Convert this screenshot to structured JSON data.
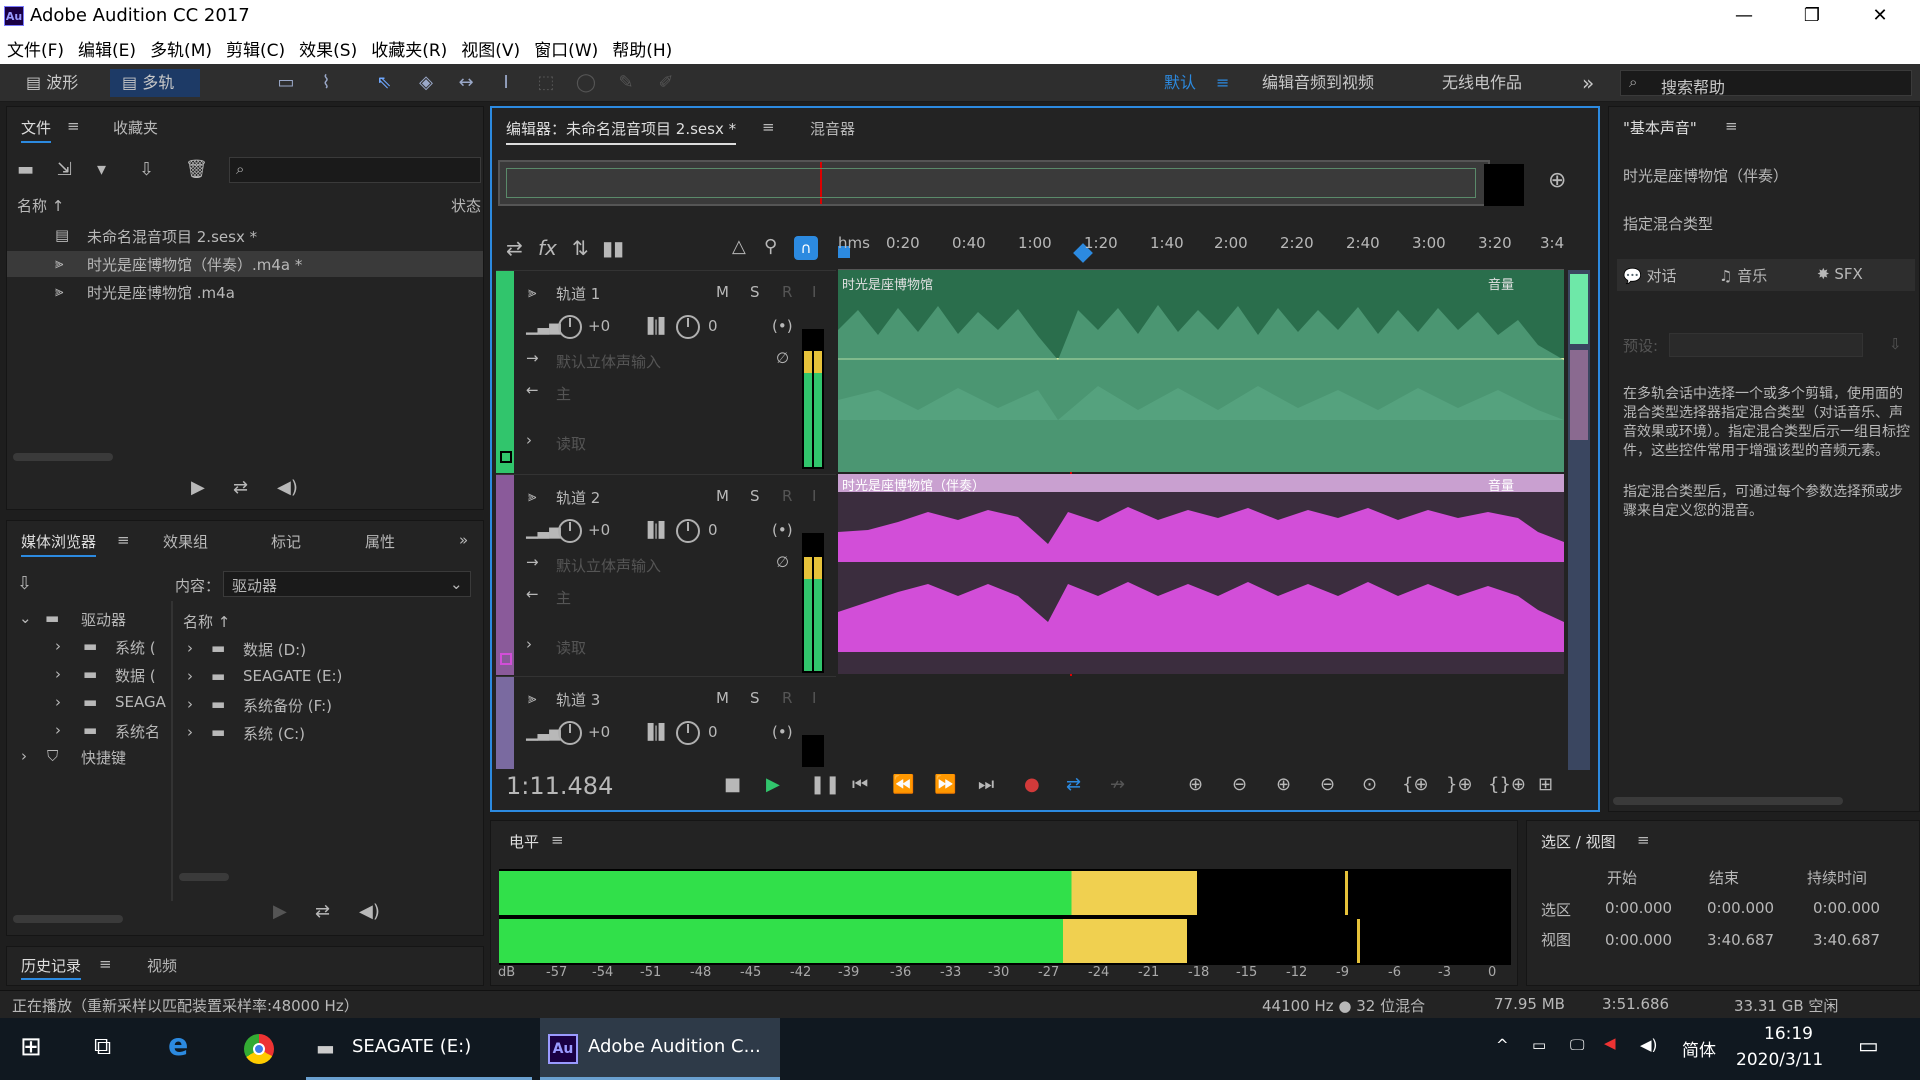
{
  "window": {
    "title": "Adobe Audition CC 2017",
    "logo": "Au",
    "minimize": "—",
    "restore": "❐",
    "close": "✕"
  },
  "menu": [
    "文件(F)",
    "编辑(E)",
    "多轨(M)",
    "剪辑(C)",
    "效果(S)",
    "收藏夹(R)",
    "视图(V)",
    "窗口(W)",
    "帮助(H)"
  ],
  "toolbar": {
    "waveform": "波形",
    "multitrack": "多轨",
    "workspace_default": "默认",
    "workspace_video": "编辑音频到视频",
    "workspace_radio": "无线电作品",
    "more": "»",
    "search_placeholder": "搜索帮助"
  },
  "files_panel": {
    "tabs": [
      "文件",
      "收藏夹"
    ],
    "col_name": "名称 ↑",
    "col_status": "状态",
    "items": [
      {
        "name": "未命名混音项目 2.sesx *",
        "type": "session"
      },
      {
        "name": "时光是座博物馆（伴奏）.m4a *",
        "type": "audio"
      },
      {
        "name": "时光是座博物馆 .m4a",
        "type": "audio"
      }
    ]
  },
  "media_browser": {
    "tabs": [
      "媒体浏览器",
      "效果组",
      "标记",
      "属性"
    ],
    "content_label": "内容：",
    "content_value": "驱动器",
    "tree_root": "驱动器",
    "tree_items": [
      "系统 (",
      "数据 (",
      "SEAGA",
      "系统名"
    ],
    "shortcuts": "快捷键",
    "col_name": "名称 ↑",
    "drives": [
      "数据 (D:)",
      "SEAGATE (E:)",
      "系统备份 (F:)",
      "系统 (C:)"
    ]
  },
  "history": {
    "tabs": [
      "历史记录",
      "视频"
    ]
  },
  "editor": {
    "tab_label": "编辑器：未命名混音项目 2.sesx *",
    "mixer_tab": "混音器",
    "timecode": "1:11.484",
    "ruler": [
      "hms",
      "0:20",
      "0:40",
      "1:00",
      "1:20",
      "1:40",
      "2:00",
      "2:20",
      "2:40",
      "3:00",
      "3:20",
      "3:4"
    ],
    "tracks": [
      {
        "name": "轨道 1",
        "m": "M",
        "s": "S",
        "r": "R",
        "i": "I",
        "vol": "+0",
        "pan": "0",
        "input": "默认立体声输入",
        "output": "主",
        "read": "读取",
        "clip": "时光是座博物馆",
        "clip_vol": "音量",
        "color": "#31c56c"
      },
      {
        "name": "轨道 2",
        "m": "M",
        "s": "S",
        "r": "R",
        "i": "I",
        "vol": "+0",
        "pan": "0",
        "input": "默认立体声输入",
        "output": "主",
        "read": "读取",
        "clip": "时光是座博物馆（伴奏）",
        "clip_vol": "音量",
        "color": "#d24ed8"
      },
      {
        "name": "轨道 3",
        "m": "M",
        "s": "S",
        "r": "R",
        "i": "I",
        "vol": "+0",
        "pan": "0",
        "color": "#7a6aa0"
      }
    ]
  },
  "levels": {
    "title": "电平",
    "scale": [
      "dB",
      "-57",
      "-54",
      "-51",
      "-48",
      "-45",
      "-42",
      "-39",
      "-36",
      "-33",
      "-30",
      "-27",
      "-24",
      "-21",
      "-18",
      "-15",
      "-12",
      "-9",
      "-6",
      "-3",
      "0"
    ]
  },
  "selection_view": {
    "title": "选区 / 视图",
    "headers": [
      "开始",
      "结束",
      "持续时间"
    ],
    "rows": [
      {
        "label": "选区",
        "start": "0:00.000",
        "end": "0:00.000",
        "dur": "0:00.000"
      },
      {
        "label": "视图",
        "start": "0:00.000",
        "end": "3:40.687",
        "dur": "3:40.687"
      }
    ]
  },
  "essential_sound": {
    "title": "\"基本声音\"",
    "clip": "时光是座博物馆（伴奏）",
    "assign": "指定混合类型",
    "types": [
      "对话",
      "音乐",
      "SFX"
    ],
    "preset_label": "预设:",
    "desc1": "在多轨会话中选择一个或多个剪辑，使用面的混合类型选择器指定混合类型（对话音乐、声音效果或环境）。指定混合类型后示一组目标控件，这些控件常用于增强该型的音频元素。",
    "desc2": "指定混合类型后，可通过每个参数选择预或步骤来自定义您的混音。"
  },
  "status": {
    "left": "正在播放（重新采样以匹配装置采样率:48000 Hz）",
    "format": "44100 Hz ● 32 位混合",
    "size": "77.95 MB",
    "duration": "3:51.686",
    "free": "33.31 GB 空闲"
  },
  "taskbar": {
    "drive": "SEAGATE (E:)",
    "app": "Adobe Audition C...",
    "ime": "简体",
    "time": "16:19",
    "date": "2020/3/11"
  },
  "meters": {
    "top": 0.69,
    "bottom": 0.68
  }
}
